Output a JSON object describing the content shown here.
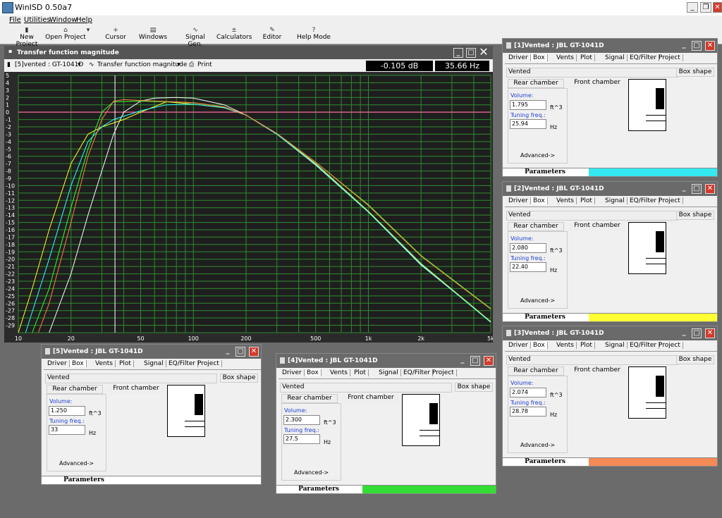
{
  "app": {
    "title": "WinISD 0.50a7"
  },
  "menu": {
    "file": "File",
    "utilities": "Utilities",
    "window": "Window",
    "help": "Help"
  },
  "toolbar": {
    "new_project": "New Project",
    "open_project": "Open Project",
    "cursor": "Cursor",
    "windows": "Windows",
    "signal_gen": "Signal Gen.",
    "calculators": "Calculators",
    "editor": "Editor",
    "help_mode": "Help Mode"
  },
  "chart_window": {
    "title": "Transfer function magnitude",
    "selector": "[5]vented : GT-1041D",
    "mode": "Transfer function magnitude",
    "print": "Print",
    "readout_db": "-0.105 dB",
    "readout_hz": "35.66 Hz"
  },
  "chart_data": {
    "type": "line",
    "xscale": "log",
    "xlim": [
      10,
      5000
    ],
    "ylim": [
      -30,
      5
    ],
    "y_ticks": [
      "5",
      "4",
      "3",
      "2",
      "1",
      "0",
      "-1",
      "-2",
      "-3",
      "-4",
      "-5",
      "-6",
      "-7",
      "-8",
      "-9",
      "-10",
      "-11",
      "-12",
      "-13",
      "-14",
      "-15",
      "-16",
      "-17",
      "-18",
      "-19",
      "-20",
      "-21",
      "-22",
      "-23",
      "-24",
      "-25",
      "-26",
      "-27",
      "-28",
      "-29"
    ],
    "x_ticks": [
      {
        "value": 10,
        "label": "10"
      },
      {
        "value": 20,
        "label": "20"
      },
      {
        "value": 50,
        "label": "50"
      },
      {
        "value": 100,
        "label": "100"
      },
      {
        "value": 200,
        "label": "200"
      },
      {
        "value": 500,
        "label": "500"
      },
      {
        "value": 1000,
        "label": "1k"
      },
      {
        "value": 2000,
        "label": "2k"
      },
      {
        "value": 5000,
        "label": "5k"
      }
    ],
    "cursor_x": 35.66,
    "reference_y": 0,
    "grid": true,
    "series": [
      {
        "color": "#ffffff",
        "points": [
          [
            15,
            -30
          ],
          [
            20,
            -22
          ],
          [
            25,
            -14
          ],
          [
            30,
            -8
          ],
          [
            35,
            -3
          ],
          [
            40,
            0
          ],
          [
            50,
            1.5
          ],
          [
            60,
            1.9
          ],
          [
            80,
            2
          ],
          [
            100,
            1.9
          ],
          [
            150,
            1
          ],
          [
            200,
            -0.4
          ],
          [
            300,
            -3
          ],
          [
            500,
            -7.2
          ],
          [
            1000,
            -13.6
          ],
          [
            2000,
            -20.8
          ],
          [
            5000,
            -28.5
          ]
        ]
      },
      {
        "color": "#ffff33",
        "points": [
          [
            10,
            -30
          ],
          [
            12,
            -24
          ],
          [
            15,
            -16
          ],
          [
            20,
            -7
          ],
          [
            25,
            -3
          ],
          [
            30,
            -2
          ],
          [
            40,
            -1
          ],
          [
            50,
            0
          ],
          [
            70,
            1.4
          ],
          [
            100,
            1.1
          ],
          [
            150,
            0.6
          ],
          [
            200,
            -0.4
          ],
          [
            300,
            -3
          ],
          [
            500,
            -7
          ],
          [
            1000,
            -13.5
          ],
          [
            2000,
            -20.6
          ],
          [
            5000,
            -28.5
          ]
        ]
      },
      {
        "color": "#33ff33",
        "points": [
          [
            12,
            -30
          ],
          [
            15,
            -24
          ],
          [
            20,
            -13
          ],
          [
            25,
            -5
          ],
          [
            30,
            0
          ],
          [
            35,
            1.4
          ],
          [
            50,
            1.5
          ],
          [
            100,
            1.3
          ],
          [
            150,
            0.7
          ],
          [
            200,
            -0.4
          ],
          [
            300,
            -2.9
          ],
          [
            500,
            -6.8
          ],
          [
            1000,
            -12.6
          ],
          [
            2000,
            -19.5
          ],
          [
            5000,
            -26.7
          ]
        ]
      },
      {
        "color": "#33ffff",
        "points": [
          [
            11,
            -30
          ],
          [
            15,
            -20
          ],
          [
            20,
            -10
          ],
          [
            25,
            -4
          ],
          [
            30,
            -2
          ],
          [
            35,
            -1
          ],
          [
            50,
            0.2
          ],
          [
            70,
            1
          ],
          [
            100,
            1.1
          ],
          [
            150,
            0.6
          ],
          [
            200,
            -0.4
          ],
          [
            300,
            -3
          ],
          [
            500,
            -7.1
          ],
          [
            1000,
            -13.6
          ],
          [
            2000,
            -20.7
          ],
          [
            5000,
            -28.6
          ]
        ]
      },
      {
        "color": "#ff8040",
        "points": [
          [
            13,
            -30
          ],
          [
            15,
            -26
          ],
          [
            20,
            -15
          ],
          [
            25,
            -6
          ],
          [
            30,
            -1
          ],
          [
            35,
            1.5
          ],
          [
            40,
            1.7
          ],
          [
            50,
            1.6
          ],
          [
            100,
            1.3
          ],
          [
            150,
            0.7
          ],
          [
            200,
            -0.4
          ],
          [
            300,
            -2.9
          ],
          [
            500,
            -6.8
          ],
          [
            1000,
            -12.7
          ],
          [
            2000,
            -19.6
          ],
          [
            5000,
            -26.8
          ]
        ]
      }
    ]
  },
  "tabs": [
    "Driver",
    "Box",
    "Vents",
    "Plot",
    "Signal",
    "EQ/Filter",
    "Project"
  ],
  "common": {
    "box_type": "Vented",
    "box_shape": "Box shape",
    "rear_chamber": "Rear chamber",
    "front_chamber": "Front chamber",
    "volume_label": "Volume:",
    "volume_unit": "ft^3",
    "tuning_label": "Tuning freq.:",
    "tuning_unit": "Hz",
    "advanced": "Advanced->",
    "parameters": "Parameters"
  },
  "project_windows": {
    "w1": {
      "title": "[1]Vented : JBL GT-1041D",
      "volume": "1.795",
      "tuning": "25.94",
      "color": "#33e8f0"
    },
    "w2": {
      "title": "[2]Vented : JBL GT-1041D",
      "volume": "2.080",
      "tuning": "22.40",
      "color": "#ffff33"
    },
    "w3": {
      "title": "[3]Vented : JBL GT-1041D",
      "volume": "2.074",
      "tuning": "28.78",
      "color": "#f58a55"
    },
    "w4": {
      "title": "[4]Vented : JBL GT-1041D",
      "volume": "2.300",
      "tuning": "27.5",
      "color": "#33dd33"
    },
    "w5": {
      "title": "[5]Vented : JBL GT-1041D",
      "volume": "1.250",
      "tuning": "33",
      "color": "#ffffff"
    }
  }
}
